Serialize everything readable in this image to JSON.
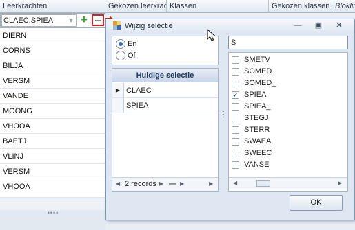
{
  "header": {
    "columns": [
      "Leerkrachten",
      "Gekozen leerkrac...",
      "Klassen",
      "Gekozen klassen",
      "Blokline"
    ]
  },
  "grid": {
    "combo_value": "CLAEC,SPIEA",
    "dots_label": "...",
    "rows": [
      "DIERN",
      "CORNS",
      "BILJA",
      "VERSM",
      "VANDE",
      "MOONG",
      "VHOOA",
      "BAETJ",
      "VLINJ",
      "VERSM",
      "VHOOA"
    ]
  },
  "dialog": {
    "title": "Wijzig selectie",
    "options": [
      "En",
      "Of"
    ],
    "selected_option": "En",
    "current_header": "Huidige selectie",
    "current_items": [
      "CLAEC",
      "SPIEA"
    ],
    "record_count": "2 records",
    "search_value": "S",
    "list_items": [
      {
        "label": "SMETV",
        "checked": false
      },
      {
        "label": "SOMED",
        "checked": false
      },
      {
        "label": "SOMED_",
        "checked": false
      },
      {
        "label": "SPIEA",
        "checked": true
      },
      {
        "label": "SPIEA_",
        "checked": false
      },
      {
        "label": "STEGJ",
        "checked": false
      },
      {
        "label": "STERR",
        "checked": false
      },
      {
        "label": "SWAEA",
        "checked": false
      },
      {
        "label": "SWEEC",
        "checked": false
      },
      {
        "label": "VANSE",
        "checked": false
      }
    ],
    "ok_label": "OK"
  }
}
